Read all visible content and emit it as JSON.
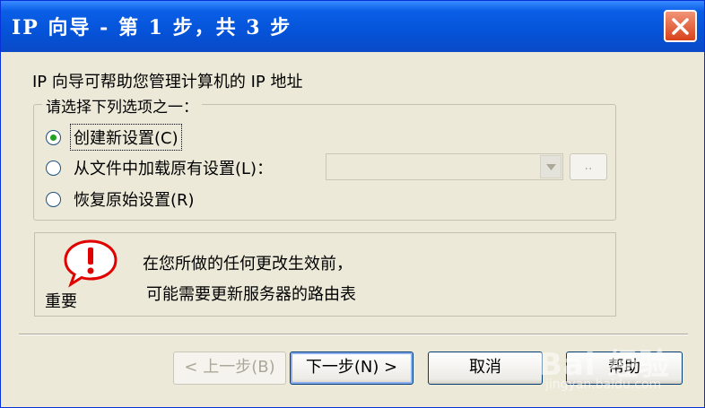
{
  "window": {
    "title": "IP 向导 - 第 1 步，共 3 步"
  },
  "intro_text": "IP 向导可帮助您管理计算机的 IP 地址",
  "options_group": {
    "legend": "请选择下列选项之一：",
    "options": [
      {
        "label": "创建新设置(C)",
        "selected": true
      },
      {
        "label": "从文件中加载原有设置(L)：",
        "selected": false
      },
      {
        "label": "恢复原始设置(R)",
        "selected": false
      }
    ],
    "browse_label": "..",
    "file_combo_value": ""
  },
  "warning": {
    "label": "重要",
    "line1": "在您所做的任何更改生效前，",
    "line2": "可能需要更新服务器的路由表"
  },
  "buttons": {
    "back": "< 上一步(B)",
    "next": "下一步(N) >",
    "cancel": "取消",
    "help": "帮助"
  },
  "watermark": {
    "text": "Bai 经验",
    "sub": "jingyan.baidu.com"
  },
  "colors": {
    "titlebar": "#0553d8",
    "close_button": "#d8421b",
    "dialog_background": "#ece9d8",
    "radio_selected": "#21a121",
    "warning_icon": "#e00000"
  }
}
